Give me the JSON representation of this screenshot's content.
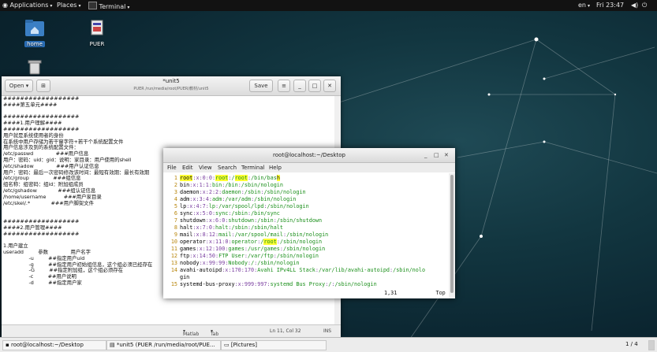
{
  "top_panel": {
    "applications": "Applications",
    "places": "Places",
    "active_app": "Terminal",
    "language": "en",
    "clock": "Fri 23:47"
  },
  "desktop": {
    "icons": [
      {
        "label": "home",
        "icon": "folder-home-icon"
      },
      {
        "label": "PUER",
        "icon": "document-icon"
      },
      {
        "label": "",
        "icon": "trash-icon"
      }
    ]
  },
  "gedit": {
    "open_label": "Open",
    "save_label": "Save",
    "title": "*unit5",
    "path": "PUER /run/media/root/PUER/教材/unit5",
    "lines": [
      "##################",
      "####第五单元####",
      "",
      "##################",
      "####1.用户理解####",
      "##################",
      "用户就是系统使用者的身份",
      "在系统中用户存储为若干窜字符+若干个系统配置文件",
      "用户信息涉及到的系统配置文件：",
      "/etc/passwd              ###用户信息",
      "用户：密码：uid：gid：说明：家目录：用户使用的shell",
      "/etc/shadow              ###用户认证信息",
      "用户：密码：最后一次密码修改该时间：最短有效期：最长有效期",
      "/etc/group               ###组信息",
      "组名称：组密码：组id：附加组成员",
      "/etc/gshadow             ###组认证信息",
      "/home/username           ###用户家目录",
      "/etc/skel/.*             ###用户脚架文件",
      "",
      "",
      "##################",
      "####2.用户管理####",
      "##################",
      "",
      "1.用户建立",
      "useradd         参数              用户名字",
      "                -u         ##指定用户uid",
      "                -g         ##指定用户初始组信息，这个组必须已经存在",
      "                -G         ##指定附加组，这个组必须存在",
      "                -c         ##用户说明",
      "                -d         ##指定用户家"
    ],
    "status": {
      "language": "Matlab",
      "tab_width": "Tab Width: 8",
      "position": "Ln 11, Col 32",
      "mode": "INS"
    }
  },
  "terminal": {
    "title": "root@localhost:~/Desktop",
    "menu": [
      "File",
      "Edit",
      "View",
      "Search",
      "Terminal",
      "Help"
    ],
    "lines": [
      {
        "n": "1",
        "text": "root:x:0:0:root:/root:/bin/bash"
      },
      {
        "n": "2",
        "text": "bin:x:1:1:bin:/bin:/sbin/nologin"
      },
      {
        "n": "3",
        "text": "daemon:x:2:2:daemon:/sbin:/sbin/nologin"
      },
      {
        "n": "4",
        "text": "adm:x:3:4:adm:/var/adm:/sbin/nologin"
      },
      {
        "n": "5",
        "text": "lp:x:4:7:lp:/var/spool/lpd:/sbin/nologin"
      },
      {
        "n": "6",
        "text": "sync:x:5:0:sync:/sbin:/bin/sync"
      },
      {
        "n": "7",
        "text": "shutdown:x:6:0:shutdown:/sbin:/sbin/shutdown"
      },
      {
        "n": "8",
        "text": "halt:x:7:0:halt:/sbin:/sbin/halt"
      },
      {
        "n": "9",
        "text": "mail:x:8:12:mail:/var/spool/mail:/sbin/nologin"
      },
      {
        "n": "10",
        "text": "operator:x:11:0:operator:/root:/sbin/nologin"
      },
      {
        "n": "11",
        "text": "games:x:12:100:games:/usr/games:/sbin/nologin"
      },
      {
        "n": "12",
        "text": "ftp:x:14:50:FTP User:/var/ftp:/sbin/nologin"
      },
      {
        "n": "13",
        "text": "nobody:x:99:99:Nobody:/:/sbin/nologin"
      },
      {
        "n": "14",
        "text": "avahi-autoipd:x:170:170:Avahi IPv4LL Stack:/var/lib/avahi-autoipd:/sbin/nolo"
      },
      {
        "n": "",
        "text": "gin"
      },
      {
        "n": "15",
        "text": "systemd-bus-proxy:x:999:997:systemd Bus Proxy:/:/sbin/nologin"
      }
    ],
    "ruler_pos": "1,31",
    "ruler_where": "Top"
  },
  "taskbar": {
    "items": [
      "root@localhost:~/Desktop",
      "*unit5 (PUER /run/media/root/PUE...",
      "[Pictures]"
    ],
    "workspace": "1 / 4"
  }
}
